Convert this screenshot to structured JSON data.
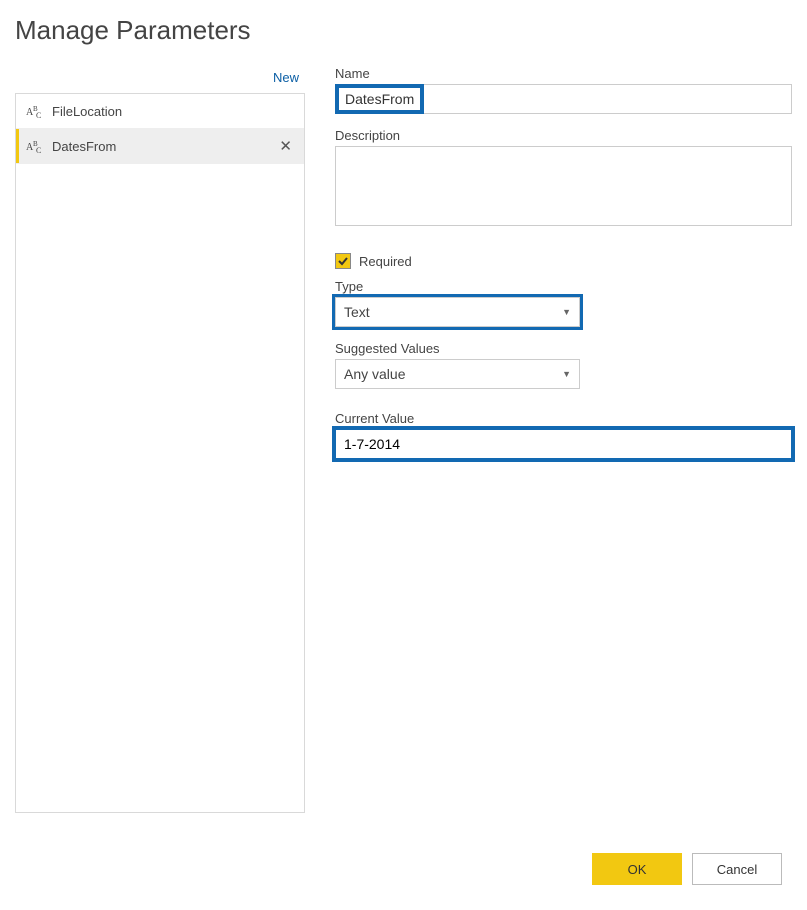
{
  "dialog": {
    "title": "Manage Parameters"
  },
  "sidebar": {
    "new_label": "New",
    "items": [
      {
        "label": "FileLocation",
        "selected": false
      },
      {
        "label": "DatesFrom",
        "selected": true
      }
    ]
  },
  "form": {
    "name_label": "Name",
    "name_value": "DatesFrom",
    "description_label": "Description",
    "description_value": "",
    "required_label": "Required",
    "required_checked": true,
    "type_label": "Type",
    "type_value": "Text",
    "suggested_label": "Suggested Values",
    "suggested_value": "Any value",
    "current_label": "Current Value",
    "current_value": "1-7-2014"
  },
  "buttons": {
    "ok": "OK",
    "cancel": "Cancel"
  },
  "colors": {
    "accent": "#f2c811",
    "highlight": "#1269b2"
  }
}
